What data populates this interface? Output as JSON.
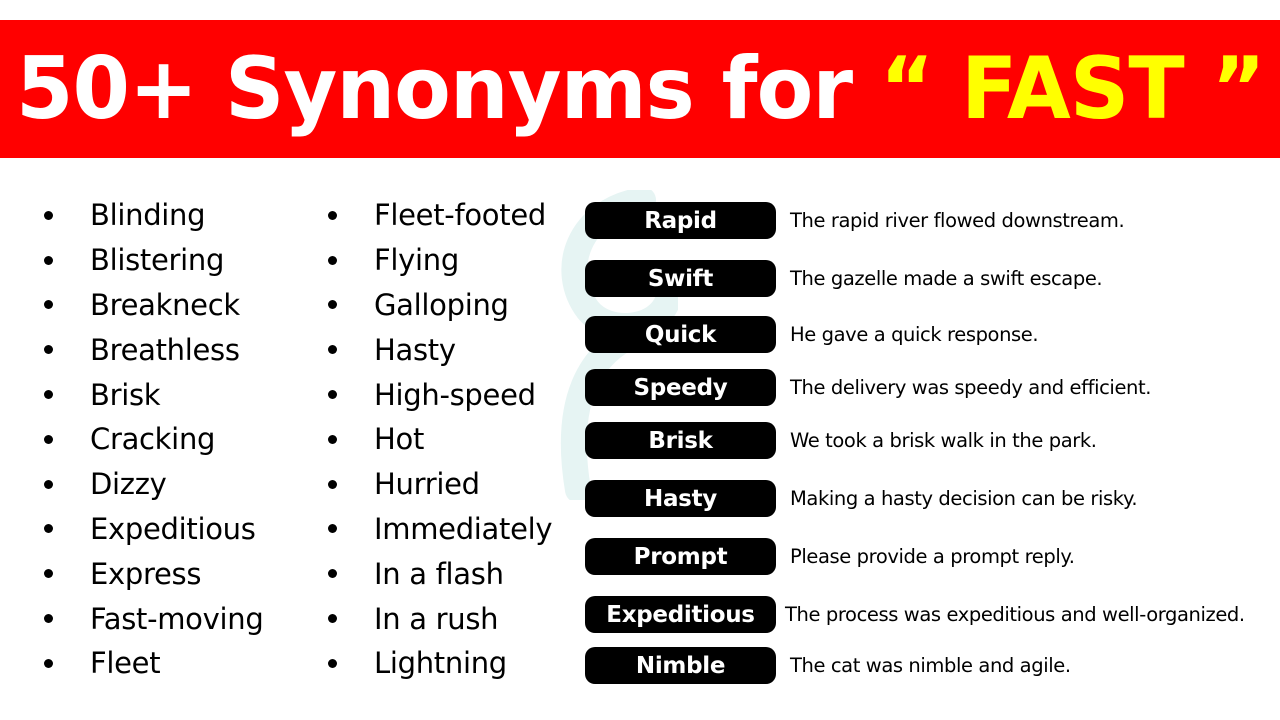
{
  "header": {
    "title_prefix": "50+ Synonyms for ",
    "title_keyword": "“ FAST ”"
  },
  "colors": {
    "banner_bg": "#ff0000",
    "title_text": "#ffffff",
    "keyword_text": "#ffff00",
    "pill_bg": "#000000",
    "pill_text": "#ffffff",
    "watermark": "#e6f4f3"
  },
  "synonyms": {
    "column_1": [
      "Blinding",
      "Blistering",
      "Breakneck",
      "Breathless",
      "Brisk",
      "Cracking",
      "Dizzy",
      "Expeditious",
      "Express",
      "Fast-moving",
      "Fleet"
    ],
    "column_2": [
      "Fleet-footed",
      "Flying",
      "Galloping",
      "Hasty",
      "High-speed",
      "Hot",
      "Hurried",
      "Immediately",
      "In a flash",
      "In a rush",
      "Lightning"
    ]
  },
  "examples": [
    {
      "word": "Rapid",
      "sentence": "The rapid river flowed downstream."
    },
    {
      "word": "Swift",
      "sentence": "The gazelle made a swift escape."
    },
    {
      "word": "Quick",
      "sentence": "He gave a quick response."
    },
    {
      "word": "Speedy",
      "sentence": "The delivery was speedy and efficient."
    },
    {
      "word": "Brisk",
      "sentence": "We took a brisk walk in the park."
    },
    {
      "word": "Hasty",
      "sentence": "Making a hasty decision can be risky."
    },
    {
      "word": "Prompt",
      "sentence": "Please provide a prompt reply."
    },
    {
      "word": "Expeditious",
      "sentence": "The process was expeditious and well-organized."
    },
    {
      "word": "Nimble",
      "sentence": "The cat was nimble and agile."
    }
  ],
  "icons": {
    "bullet": "bullet-dot",
    "watermark": "watermark-logo"
  }
}
